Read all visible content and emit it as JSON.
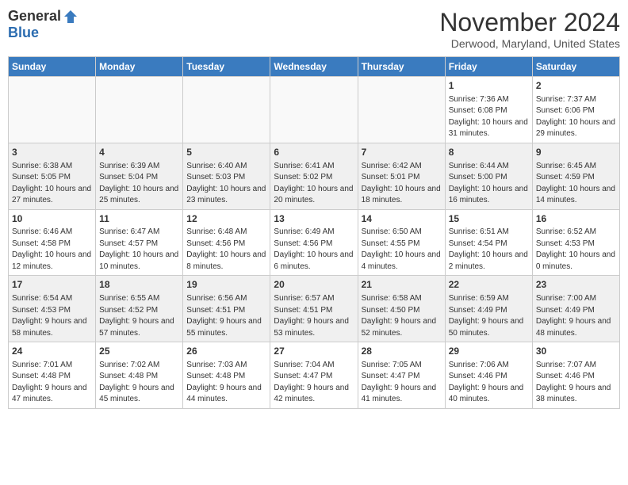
{
  "logo": {
    "general": "General",
    "blue": "Blue"
  },
  "title": "November 2024",
  "location": "Derwood, Maryland, United States",
  "days_of_week": [
    "Sunday",
    "Monday",
    "Tuesday",
    "Wednesday",
    "Thursday",
    "Friday",
    "Saturday"
  ],
  "weeks": [
    [
      {
        "day": "",
        "info": ""
      },
      {
        "day": "",
        "info": ""
      },
      {
        "day": "",
        "info": ""
      },
      {
        "day": "",
        "info": ""
      },
      {
        "day": "",
        "info": ""
      },
      {
        "day": "1",
        "info": "Sunrise: 7:36 AM\nSunset: 6:08 PM\nDaylight: 10 hours and 31 minutes."
      },
      {
        "day": "2",
        "info": "Sunrise: 7:37 AM\nSunset: 6:06 PM\nDaylight: 10 hours and 29 minutes."
      }
    ],
    [
      {
        "day": "3",
        "info": "Sunrise: 6:38 AM\nSunset: 5:05 PM\nDaylight: 10 hours and 27 minutes."
      },
      {
        "day": "4",
        "info": "Sunrise: 6:39 AM\nSunset: 5:04 PM\nDaylight: 10 hours and 25 minutes."
      },
      {
        "day": "5",
        "info": "Sunrise: 6:40 AM\nSunset: 5:03 PM\nDaylight: 10 hours and 23 minutes."
      },
      {
        "day": "6",
        "info": "Sunrise: 6:41 AM\nSunset: 5:02 PM\nDaylight: 10 hours and 20 minutes."
      },
      {
        "day": "7",
        "info": "Sunrise: 6:42 AM\nSunset: 5:01 PM\nDaylight: 10 hours and 18 minutes."
      },
      {
        "day": "8",
        "info": "Sunrise: 6:44 AM\nSunset: 5:00 PM\nDaylight: 10 hours and 16 minutes."
      },
      {
        "day": "9",
        "info": "Sunrise: 6:45 AM\nSunset: 4:59 PM\nDaylight: 10 hours and 14 minutes."
      }
    ],
    [
      {
        "day": "10",
        "info": "Sunrise: 6:46 AM\nSunset: 4:58 PM\nDaylight: 10 hours and 12 minutes."
      },
      {
        "day": "11",
        "info": "Sunrise: 6:47 AM\nSunset: 4:57 PM\nDaylight: 10 hours and 10 minutes."
      },
      {
        "day": "12",
        "info": "Sunrise: 6:48 AM\nSunset: 4:56 PM\nDaylight: 10 hours and 8 minutes."
      },
      {
        "day": "13",
        "info": "Sunrise: 6:49 AM\nSunset: 4:56 PM\nDaylight: 10 hours and 6 minutes."
      },
      {
        "day": "14",
        "info": "Sunrise: 6:50 AM\nSunset: 4:55 PM\nDaylight: 10 hours and 4 minutes."
      },
      {
        "day": "15",
        "info": "Sunrise: 6:51 AM\nSunset: 4:54 PM\nDaylight: 10 hours and 2 minutes."
      },
      {
        "day": "16",
        "info": "Sunrise: 6:52 AM\nSunset: 4:53 PM\nDaylight: 10 hours and 0 minutes."
      }
    ],
    [
      {
        "day": "17",
        "info": "Sunrise: 6:54 AM\nSunset: 4:53 PM\nDaylight: 9 hours and 58 minutes."
      },
      {
        "day": "18",
        "info": "Sunrise: 6:55 AM\nSunset: 4:52 PM\nDaylight: 9 hours and 57 minutes."
      },
      {
        "day": "19",
        "info": "Sunrise: 6:56 AM\nSunset: 4:51 PM\nDaylight: 9 hours and 55 minutes."
      },
      {
        "day": "20",
        "info": "Sunrise: 6:57 AM\nSunset: 4:51 PM\nDaylight: 9 hours and 53 minutes."
      },
      {
        "day": "21",
        "info": "Sunrise: 6:58 AM\nSunset: 4:50 PM\nDaylight: 9 hours and 52 minutes."
      },
      {
        "day": "22",
        "info": "Sunrise: 6:59 AM\nSunset: 4:49 PM\nDaylight: 9 hours and 50 minutes."
      },
      {
        "day": "23",
        "info": "Sunrise: 7:00 AM\nSunset: 4:49 PM\nDaylight: 9 hours and 48 minutes."
      }
    ],
    [
      {
        "day": "24",
        "info": "Sunrise: 7:01 AM\nSunset: 4:48 PM\nDaylight: 9 hours and 47 minutes."
      },
      {
        "day": "25",
        "info": "Sunrise: 7:02 AM\nSunset: 4:48 PM\nDaylight: 9 hours and 45 minutes."
      },
      {
        "day": "26",
        "info": "Sunrise: 7:03 AM\nSunset: 4:48 PM\nDaylight: 9 hours and 44 minutes."
      },
      {
        "day": "27",
        "info": "Sunrise: 7:04 AM\nSunset: 4:47 PM\nDaylight: 9 hours and 42 minutes."
      },
      {
        "day": "28",
        "info": "Sunrise: 7:05 AM\nSunset: 4:47 PM\nDaylight: 9 hours and 41 minutes."
      },
      {
        "day": "29",
        "info": "Sunrise: 7:06 AM\nSunset: 4:46 PM\nDaylight: 9 hours and 40 minutes."
      },
      {
        "day": "30",
        "info": "Sunrise: 7:07 AM\nSunset: 4:46 PM\nDaylight: 9 hours and 38 minutes."
      }
    ]
  ]
}
